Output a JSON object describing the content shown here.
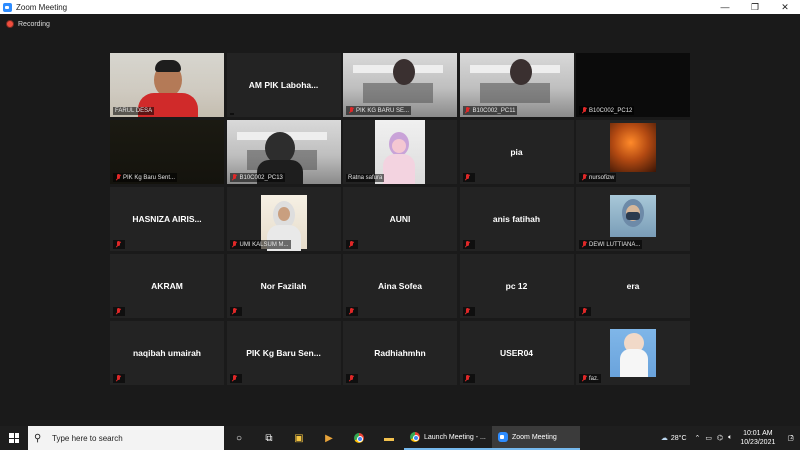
{
  "window": {
    "title": "Zoom Meeting",
    "controls": {
      "minimize": "—",
      "restore": "❐",
      "close": "✕"
    }
  },
  "recording": {
    "label": "Recording",
    "color": "#f04e3e"
  },
  "active_speaker_color": "#a4d36d",
  "participants": [
    {
      "name": "FARUL DESA",
      "video": true,
      "muted": false,
      "active": true
    },
    {
      "name": "AM PIK Laboha...",
      "video": false,
      "muted": false
    },
    {
      "name": "PIK KG BARU SE...",
      "video": true,
      "muted": true
    },
    {
      "name": "B10C002_PC11",
      "video": true,
      "muted": true
    },
    {
      "name": "B10C002_PC12",
      "video": true,
      "muted": true
    },
    {
      "name": "PIK Kg Baru Sent...",
      "video": true,
      "muted": true
    },
    {
      "name": "B10C002_PC13",
      "video": true,
      "muted": true
    },
    {
      "name": "Ratna safura",
      "video": true,
      "muted": false
    },
    {
      "name": "pia",
      "video": false,
      "muted": true
    },
    {
      "name": "nursofizw",
      "video": true,
      "muted": true
    },
    {
      "name": "HASNIZA AIRIS...",
      "video": false,
      "muted": true
    },
    {
      "name": "UMI KALSUM M...",
      "video": true,
      "muted": true
    },
    {
      "name": "AUNI",
      "video": false,
      "muted": true
    },
    {
      "name": "anis fatihah",
      "video": false,
      "muted": true
    },
    {
      "name": "DEWI LUTTIANA...",
      "video": true,
      "muted": true
    },
    {
      "name": "AKRAM",
      "video": false,
      "muted": true
    },
    {
      "name": "Nor Fazilah",
      "video": false,
      "muted": true
    },
    {
      "name": "Aina Sofea",
      "video": false,
      "muted": true
    },
    {
      "name": "pc 12",
      "video": false,
      "muted": true
    },
    {
      "name": "era",
      "video": false,
      "muted": true
    },
    {
      "name": "naqibah umairah",
      "video": false,
      "muted": true
    },
    {
      "name": "PIK Kg Baru Sen...",
      "video": false,
      "muted": true
    },
    {
      "name": "Radhiahmhn",
      "video": false,
      "muted": true
    },
    {
      "name": "USER04",
      "video": false,
      "muted": true
    },
    {
      "name": "faz.",
      "video": true,
      "muted": true
    }
  ],
  "taskbar": {
    "search_placeholder": "Type here to search",
    "apps": [
      {
        "label": "Launch Meeting - ...",
        "icon": "chrome-icon"
      },
      {
        "label": "Zoom Meeting",
        "icon": "zoom-icon"
      }
    ],
    "weather": "28°C",
    "time": "10:01 AM",
    "date": "10/23/2021",
    "notifications": "2"
  }
}
